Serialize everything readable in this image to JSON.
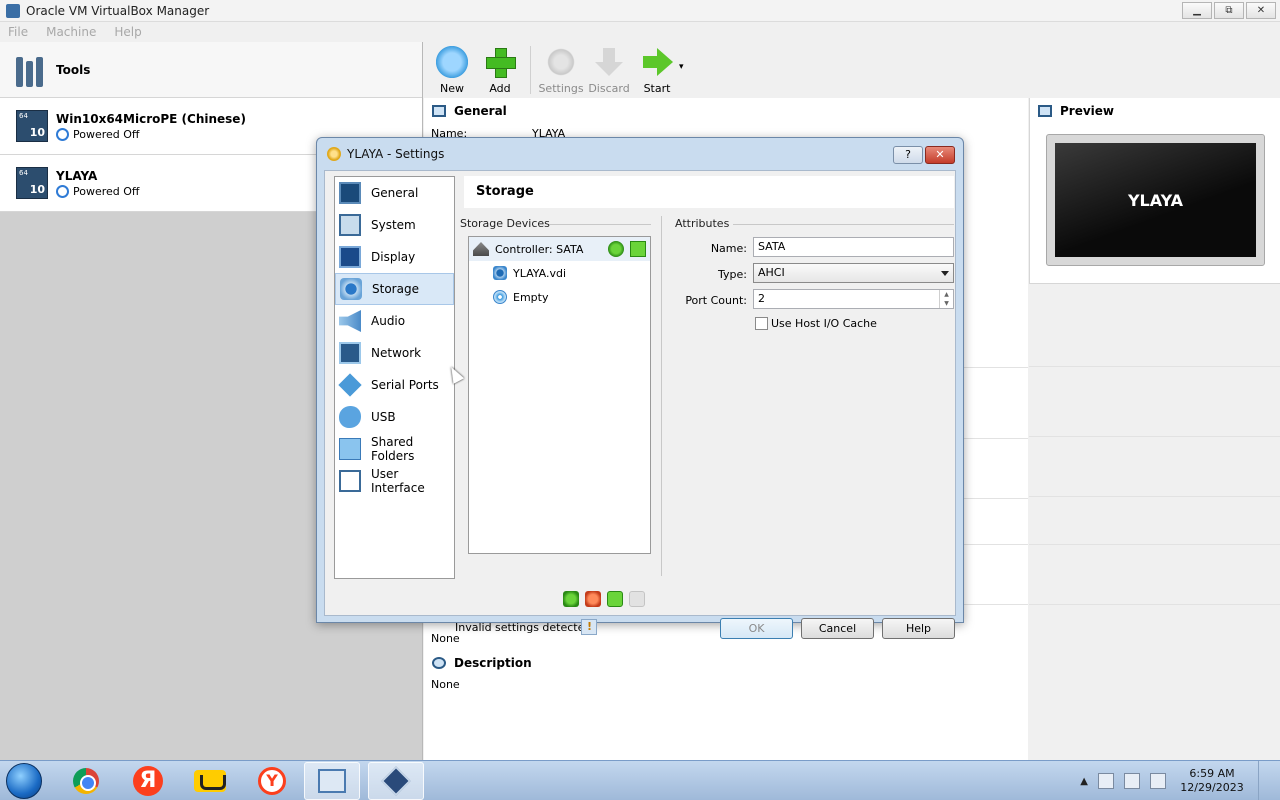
{
  "window": {
    "title": "Oracle VM VirtualBox Manager",
    "controls": [
      "▁",
      "⧉",
      "✕"
    ]
  },
  "menubar": {
    "items": [
      "File",
      "Machine",
      "Help"
    ]
  },
  "leftpane": {
    "tools_label": "Tools",
    "vms": [
      {
        "name": "Win10x64MicroPE (Chinese)",
        "state": "Powered Off",
        "badge_top": "64",
        "badge_num": "10"
      },
      {
        "name": "YLAYA",
        "state": "Powered Off",
        "badge_top": "64",
        "badge_num": "10"
      }
    ]
  },
  "toolbar": {
    "new": "New",
    "add": "Add",
    "settings": "Settings",
    "discard": "Discard",
    "start": "Start",
    "dropdown": "▾"
  },
  "details": {
    "general_title": "General",
    "name_row": "Name:",
    "name_val": "YLAYA",
    "usb_none": "None",
    "description_title": "Description",
    "description_val": "None"
  },
  "preview": {
    "title": "Preview",
    "screen_text": "YLAYA"
  },
  "dialog": {
    "title": "YLAYA - Settings",
    "help_btn": "?",
    "close_btn": "✕",
    "categories": [
      "General",
      "System",
      "Display",
      "Storage",
      "Audio",
      "Network",
      "Serial Ports",
      "USB",
      "Shared Folders",
      "User Interface"
    ],
    "selected_category": "Storage",
    "page_title": "Storage",
    "storage_devices_label": "Storage Devices",
    "attributes_label": "Attributes",
    "controller": "Controller: SATA",
    "devices": [
      "YLAYA.vdi",
      "Empty"
    ],
    "attr": {
      "name_label": "Name:",
      "name_value": "SATA",
      "type_label": "Type:",
      "type_value": "AHCI",
      "port_label": "Port Count:",
      "port_value": "2",
      "cache_label": "Use Host I/O Cache"
    },
    "warning": "Invalid settings detected",
    "ok": "OK",
    "cancel": "Cancel",
    "help": "Help"
  },
  "taskbar": {
    "time": "6:59 AM",
    "date": "12/29/2023",
    "ya_letter": "Я",
    "yb_letter": "Y",
    "tray_up": "▲"
  }
}
